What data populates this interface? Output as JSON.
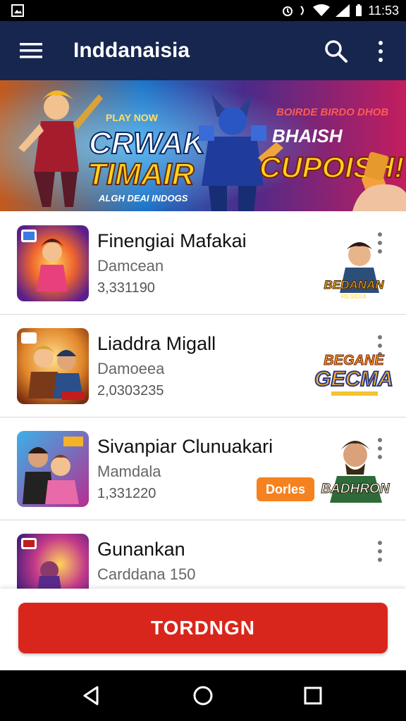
{
  "status": {
    "time": "11:53"
  },
  "appbar": {
    "title": "Inddanaisia",
    "icons": [
      "menu-icon",
      "search-icon",
      "more-vert-icon"
    ]
  },
  "banner": {
    "left_small": "PLAY NOW",
    "left_title_1": "CRWAK",
    "left_title_2": "TIMAIR",
    "left_tag": "ALGH DEAI INDOGS",
    "right_small": "BOIRDE BIRDO DHOB",
    "right_title_1": "BHAISH",
    "right_title_2": "CUPOISH!"
  },
  "list": {
    "items": [
      {
        "name": "Finengiai Mafakai",
        "sub": "Damcean",
        "count": "3,331190",
        "side_text_1": "BEDANAN",
        "side_text_2": "RESIDIA"
      },
      {
        "name": "Liaddra Migall",
        "sub": "Damoeea",
        "count": "2,0303235",
        "side_text_1": "BEGANE",
        "side_text_2": "GECMA"
      },
      {
        "name": "Sivanpiar Clunuakari",
        "sub": "Mamdala",
        "count": "1,331220",
        "chip": "Dorles",
        "side_text_1": "BADHRON"
      },
      {
        "name": "Gunankan",
        "sub": "Carddana 150",
        "count": ""
      }
    ]
  },
  "cta": {
    "label": "TORDNGN"
  },
  "colors": {
    "appbar": "#16264f",
    "cta": "#d9261c",
    "chip": "#f5821f"
  }
}
